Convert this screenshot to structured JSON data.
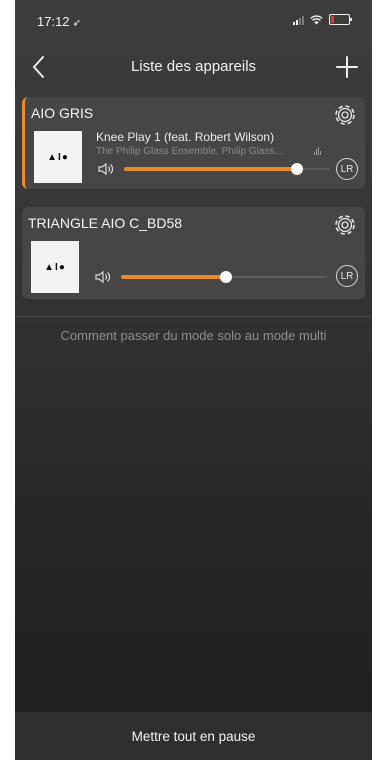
{
  "status_bar": {
    "time": "17:12",
    "location_glyph": "➶"
  },
  "nav": {
    "title": "Liste des appareils",
    "back_icon": "chevron-left-icon",
    "add_icon": "plus-icon"
  },
  "colors": {
    "accent": "#e8892b",
    "background": "#353535",
    "card": "#464646"
  },
  "devices": [
    {
      "name": "AIO GRIS",
      "active": true,
      "album_art_text": "▲I●",
      "track_title": "Knee Play 1 (feat. Robert Wilson)",
      "track_artist": "The Philip Glass Ensemble, Philip Glass...",
      "volume": 0.84,
      "lr_label": "LR",
      "settings_icon": "gear-icon"
    },
    {
      "name": "TRIANGLE AIO C_BD58",
      "active": false,
      "album_art_text": "▲I●",
      "track_title": "",
      "track_artist": "",
      "volume": 0.51,
      "lr_label": "LR",
      "settings_icon": "gear-icon"
    }
  ],
  "help_link": "Comment passer du mode solo au mode multi",
  "footer_button": "Mettre tout en pause"
}
